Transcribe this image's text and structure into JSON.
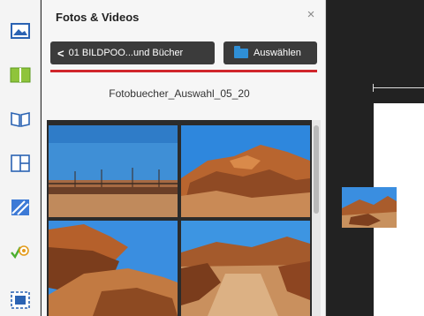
{
  "panel": {
    "title": "Fotos & Videos",
    "close_glyph": "×",
    "back_button_label": "01 BILDPOO...und Bücher",
    "back_chevron": "<",
    "select_button_label": "Auswählen",
    "folder_name": "Fotobuecher_Auswahl_05_20"
  },
  "toolstrip": {
    "items": [
      {
        "name": "photo-icon"
      },
      {
        "name": "layout-icon"
      },
      {
        "name": "book-icon"
      },
      {
        "name": "grid-layout-icon"
      },
      {
        "name": "pattern-icon"
      },
      {
        "name": "effects-icon"
      },
      {
        "name": "frame-icon"
      }
    ]
  },
  "thumbnails": [
    {
      "name": "photo-desert-fence"
    },
    {
      "name": "photo-red-rocks-blue-sky"
    },
    {
      "name": "photo-rock-formation"
    },
    {
      "name": "photo-canyon-path"
    }
  ],
  "colors": {
    "accent": "#d0262c",
    "button": "#3b3b3b",
    "folder": "#2f8fd6"
  }
}
